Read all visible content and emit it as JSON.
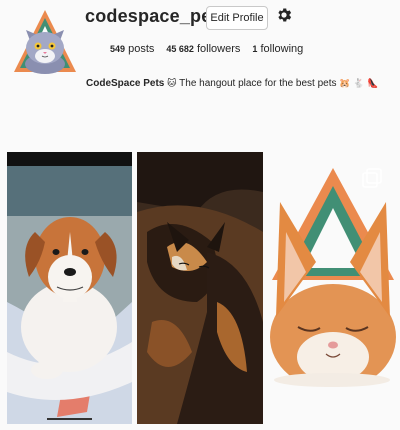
{
  "profile": {
    "username": "codespace_pets",
    "edit_label": "Edit Profile",
    "stats": [
      {
        "value": "549",
        "label": "posts"
      },
      {
        "value": "45 682",
        "label": "followers"
      },
      {
        "value": "1",
        "label": "following"
      }
    ],
    "bio": {
      "name": "CodeSpace Pets",
      "emoji_after_name": "🐱",
      "text": "The hangout place for the best pets",
      "trailing_emojis": "🐹 🐇 👠"
    }
  },
  "posts": [
    {
      "subject": "puppy",
      "multi_photo": false
    },
    {
      "subject": "tortoiseshell cat",
      "multi_photo": false
    },
    {
      "subject": "orange cat",
      "multi_photo": true
    }
  ],
  "colors": {
    "accent_green": "#2f8f7a",
    "accent_orange": "#e8762f"
  }
}
